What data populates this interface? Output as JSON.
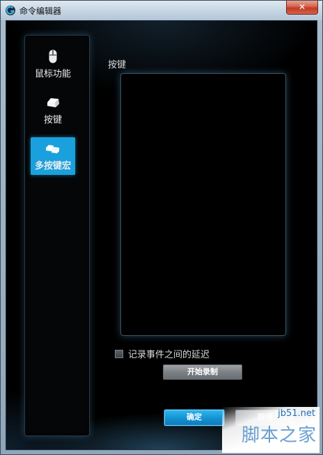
{
  "window": {
    "title": "命令编辑器",
    "close_glyph": "✕"
  },
  "sidebar": {
    "items": [
      {
        "label": "鼠标功能",
        "icon": "mouse-icon",
        "active": false
      },
      {
        "label": "按键",
        "icon": "key-icon",
        "active": false
      },
      {
        "label": "多按键宏",
        "icon": "multi-key-icon",
        "active": true
      }
    ]
  },
  "main": {
    "keys_label": "按键",
    "delay_checkbox_label": "记录事件之间的延迟",
    "delay_checked": false,
    "record_button": "开始录制"
  },
  "footer": {
    "ok_button": "确定",
    "cancel_button": "取消"
  },
  "watermark": {
    "site": "jb51.net",
    "name": "脚本之家"
  },
  "colors": {
    "accent": "#1aa0dc",
    "close": "#c23a22",
    "background": "#000000"
  }
}
